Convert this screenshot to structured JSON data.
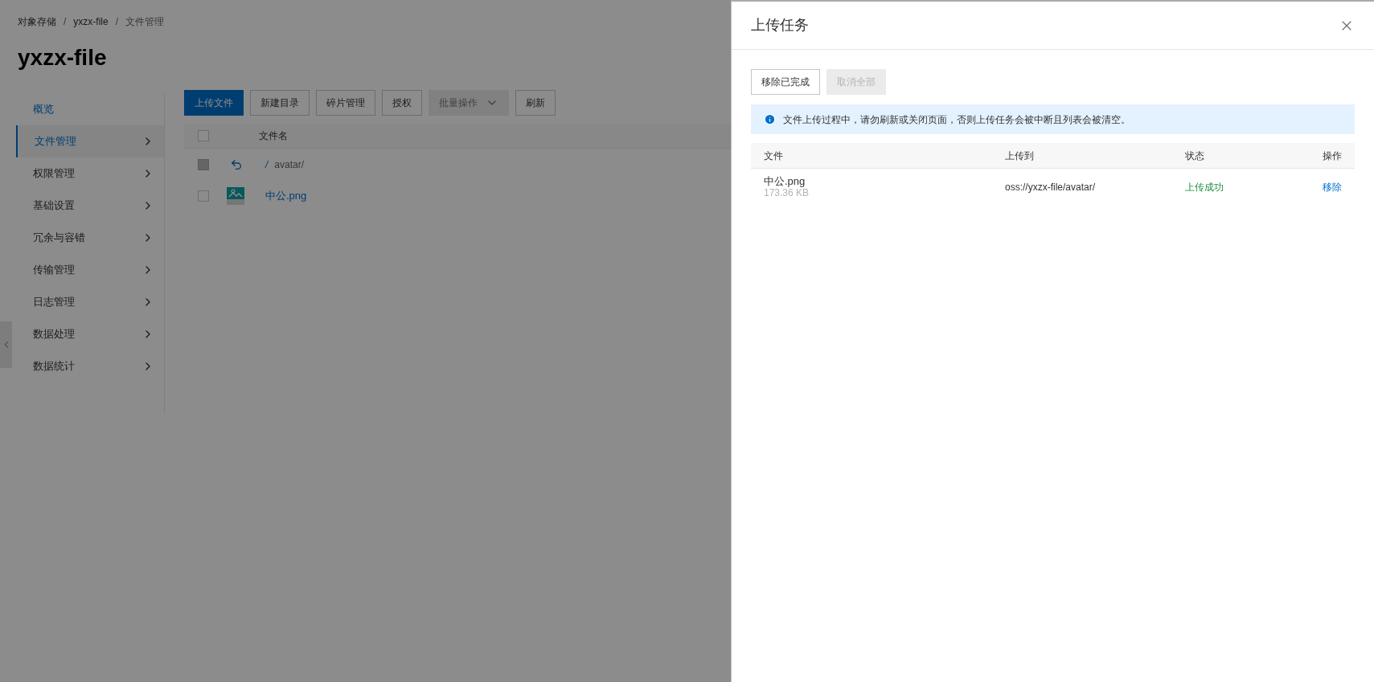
{
  "breadcrumb": {
    "separator": "/",
    "items": [
      "对象存储",
      "yxzx-file",
      "文件管理"
    ]
  },
  "title": "yxzx-file",
  "sidebar": {
    "items": [
      {
        "label": "概览",
        "kind": "link",
        "selected": false
      },
      {
        "label": "文件管理",
        "kind": "group",
        "selected": true
      },
      {
        "label": "权限管理",
        "kind": "group",
        "selected": false
      },
      {
        "label": "基础设置",
        "kind": "group",
        "selected": false
      },
      {
        "label": "冗余与容错",
        "kind": "group",
        "selected": false
      },
      {
        "label": "传输管理",
        "kind": "group",
        "selected": false
      },
      {
        "label": "日志管理",
        "kind": "group",
        "selected": false
      },
      {
        "label": "数据处理",
        "kind": "group",
        "selected": false
      },
      {
        "label": "数据统计",
        "kind": "group",
        "selected": false
      }
    ]
  },
  "toolbar": [
    {
      "label": "上传文件",
      "kind": "primary",
      "disabled": false
    },
    {
      "label": "新建目录",
      "kind": "default",
      "disabled": false
    },
    {
      "label": "碎片管理",
      "kind": "default",
      "disabled": false
    },
    {
      "label": "授权",
      "kind": "default",
      "disabled": false
    },
    {
      "label": "批量操作",
      "kind": "dropdown",
      "disabled": true
    },
    {
      "label": "刷新",
      "kind": "default",
      "disabled": false
    }
  ],
  "file_table": {
    "select_all_checked": false,
    "columns": [
      "文件名"
    ],
    "rows": [
      {
        "kind": "parent",
        "slash": "/",
        "name": "avatar/",
        "disabled": true
      },
      {
        "kind": "file",
        "name": "中公.png",
        "disabled": false
      }
    ]
  },
  "drawer": {
    "title": "上传任务",
    "buttons": [
      {
        "label": "移除已完成",
        "disabled": false
      },
      {
        "label": "取消全部",
        "disabled": true
      }
    ],
    "notice": "文件上传过程中，请勿刷新或关闭页面，否则上传任务会被中断且列表会被清空。",
    "table": {
      "columns": [
        "文件",
        "上传到",
        "状态",
        "操作"
      ],
      "rows": [
        {
          "file": "中公.png",
          "size": "173.36 KB",
          "destination": "oss://yxzx-file/avatar/",
          "status": "上传成功",
          "action": "移除"
        }
      ]
    }
  }
}
